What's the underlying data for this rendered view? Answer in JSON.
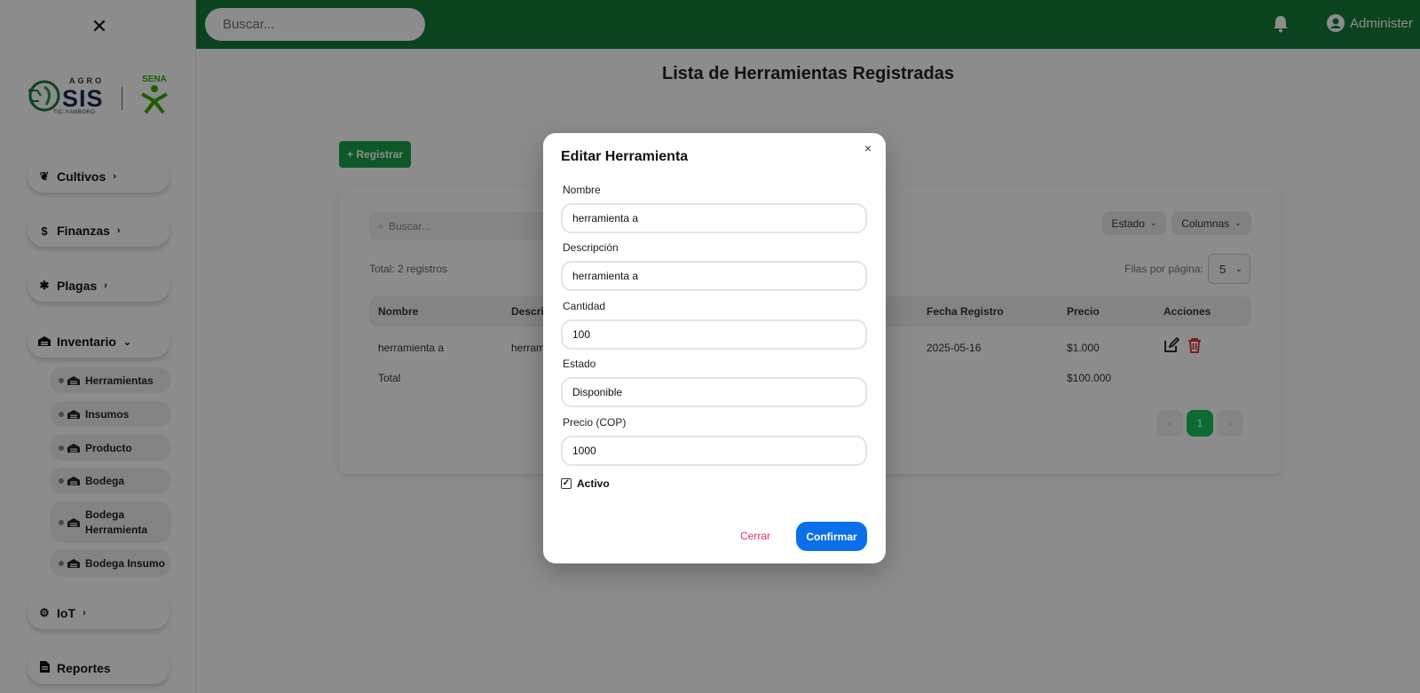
{
  "sidebar": {
    "close_glyph": "✕",
    "logo": {
      "agro": "AGRO",
      "sis": "SIS",
      "tic": "TIC-YAMBORÓ",
      "sena": "SENA"
    },
    "menu": [
      {
        "label": "Cultivos",
        "icon": "leaf-icon",
        "chevron": "›"
      },
      {
        "label": "Finanzas",
        "icon": "dollar-icon",
        "chevron": "›"
      },
      {
        "label": "Plagas",
        "icon": "bug-icon",
        "chevron": "›"
      },
      {
        "label": "Inventario",
        "icon": "warehouse-icon",
        "chevron": "⌄"
      },
      {
        "label": "IoT",
        "icon": "chip-icon",
        "chevron": "›"
      },
      {
        "label": "Reportes",
        "icon": "file-icon",
        "chevron": ""
      }
    ],
    "inventario_sub": [
      {
        "label": "Herramientas"
      },
      {
        "label": "Insumos"
      },
      {
        "label": "Producto"
      },
      {
        "label": "Bodega"
      },
      {
        "label": "Bodega Herramienta"
      },
      {
        "label": "Bodega Insumo"
      }
    ]
  },
  "header": {
    "search_placeholder": "Buscar...",
    "user_name": "Administer",
    "bg_color": "#157a3a"
  },
  "main": {
    "title": "Lista de Herramientas Registradas",
    "register_label": "+ Registrar",
    "table_search_placeholder": "Buscar...",
    "estado_label": "Estado",
    "columnas_label": "Columnas",
    "dropdown_chevron": "⌄",
    "total_label": "Total: 2 registros",
    "rows_per_page_label": "Filas por página:",
    "rows_per_page_value": "5",
    "columns": [
      "Nombre",
      "Descrip",
      "Fecha Registro",
      "Precio",
      "Acciones"
    ],
    "row": {
      "nombre": "herramienta a",
      "descripcion": "herram",
      "fecha": "2025-05-16",
      "precio": "$1.000"
    },
    "total_row": {
      "label": "Total",
      "value": "$100.000"
    },
    "pagination": {
      "prev": "‹",
      "current": "1",
      "next": "›"
    }
  },
  "modal": {
    "title": "Editar Herramienta",
    "close_glyph": "×",
    "fields": [
      {
        "label": "Nombre",
        "value": "herramienta a"
      },
      {
        "label": "Descripción",
        "value": "herramienta a"
      },
      {
        "label": "Cantidad",
        "value": "100"
      },
      {
        "label": "Estado",
        "value": "Disponible"
      },
      {
        "label": "Precio (COP)",
        "value": "1000"
      }
    ],
    "checkbox_label": "Activo",
    "checkbox_checked": true,
    "check_glyph": "✓",
    "cancel_label": "Cerrar",
    "confirm_label": "Confirmar",
    "accent_color": "#0a6fe8"
  }
}
